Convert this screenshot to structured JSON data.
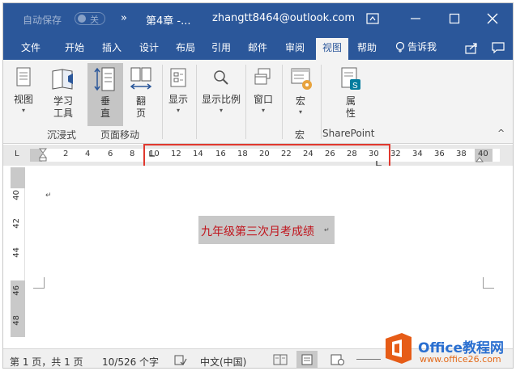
{
  "titlebar": {
    "autosave_label": "自动保存",
    "autosave_state": "关",
    "overflow_glyph": "»",
    "doc_title": "第4章 -...",
    "account": "zhangtt8464@outlook.com",
    "buttons": [
      "restore-ribbon",
      "minimize",
      "maximize",
      "close"
    ]
  },
  "tabs": {
    "items": [
      "文件",
      "开始",
      "插入",
      "设计",
      "布局",
      "引用",
      "邮件",
      "审阅",
      "视图",
      "帮助"
    ],
    "active": "视图",
    "tell_me": "告诉我"
  },
  "ribbon": {
    "groups": [
      {
        "label": "沉浸式",
        "buttons": [
          {
            "label": "视图",
            "arrow": "▾"
          },
          {
            "label1": "学习",
            "label2": "工具"
          }
        ]
      },
      {
        "label": "页面移动",
        "buttons": [
          {
            "label1": "垂",
            "label2": "直"
          },
          {
            "label1": "翻",
            "label2": "页"
          }
        ]
      },
      {
        "label": "",
        "buttons": [
          {
            "label": "显示",
            "arrow": "▾"
          },
          {
            "label": "显示比例",
            "arrow": "▾"
          },
          {
            "label": "窗口",
            "arrow": "▾"
          }
        ]
      },
      {
        "label": "宏",
        "buttons": [
          {
            "label": "宏",
            "arrow": "▾"
          }
        ]
      },
      {
        "label": "SharePoint",
        "buttons": [
          {
            "label1": "属",
            "label2": "性"
          }
        ]
      }
    ],
    "collapse_glyph": "^"
  },
  "ruler": {
    "tab_glyph": "L",
    "numbers": [
      "2",
      "4",
      "6",
      "8",
      "10",
      "12",
      "14",
      "16",
      "18",
      "20",
      "22",
      "24",
      "26",
      "28",
      "30",
      "32",
      "34",
      "36",
      "38",
      "40"
    ],
    "vertical_numbers": [
      "40",
      "42",
      "44",
      "46",
      "48"
    ]
  },
  "document": {
    "heading": "九年级第三次月考成绩",
    "para_mark": "↵"
  },
  "status": {
    "page": "第 1 页，共 1 页",
    "words": "10/526 个字",
    "language": "中文(中国)"
  },
  "watermark": {
    "brand": "Office教程网",
    "url": "www.office26.com"
  },
  "colors": {
    "accent": "#2b579a",
    "highlight_box": "#e0382e",
    "heading_text": "#c0141c"
  }
}
